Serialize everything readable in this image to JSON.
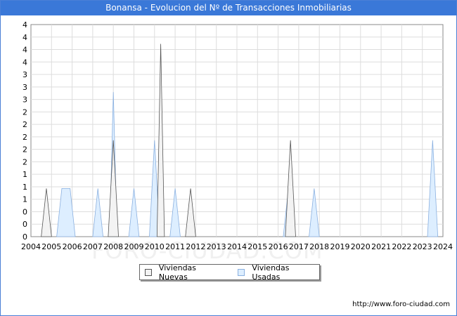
{
  "page": {
    "title": "Bonansa - Evolucion del Nº de Transacciones Inmobiliarias",
    "footer": "http://www.foro-ciudad.com",
    "watermark": "FORO-CIUDAD.COM"
  },
  "chart_data": {
    "type": "area",
    "title": "Bonansa - Evolucion del Nº de Transacciones Inmobiliarias",
    "x_ticks": [
      "2004",
      "2005",
      "2006",
      "2007",
      "2008",
      "2009",
      "2010",
      "2011",
      "2012",
      "2013",
      "2014",
      "2015",
      "2016",
      "2017",
      "2018",
      "2019",
      "2020",
      "2021",
      "2022",
      "2023",
      "2024"
    ],
    "y_ticks": [
      "0",
      "0",
      "0",
      "1",
      "1",
      "1",
      "2",
      "2",
      "2",
      "2",
      "2",
      "3",
      "3",
      "3",
      "4",
      "4",
      "4",
      "4"
    ],
    "ylim": [
      0,
      4.4
    ],
    "xlim": [
      2004,
      2024
    ],
    "grid": true,
    "legend_position": "bottom-center",
    "series": [
      {
        "name": "Viviendas Nuevas",
        "color": "#f3f3f3",
        "stroke": "#555555",
        "spikes": [
          {
            "x": 2004.75,
            "value": 1
          },
          {
            "x": 2008.0,
            "value": 2
          },
          {
            "x": 2010.3,
            "value": 4
          },
          {
            "x": 2011.75,
            "value": 1
          },
          {
            "x": 2016.6,
            "value": 2
          }
        ]
      },
      {
        "name": "Viviendas Usadas",
        "color": "#ddeeff",
        "stroke": "#8ab0e0",
        "plateaus": [
          {
            "start": 2005.5,
            "end": 2005.9,
            "value": 1
          }
        ],
        "spikes": [
          {
            "x": 2007.25,
            "value": 1
          },
          {
            "x": 2008.0,
            "value": 3
          },
          {
            "x": 2009.0,
            "value": 1
          },
          {
            "x": 2010.0,
            "value": 2
          },
          {
            "x": 2011.0,
            "value": 1
          },
          {
            "x": 2016.5,
            "value": 1
          },
          {
            "x": 2017.75,
            "value": 1
          },
          {
            "x": 2023.5,
            "value": 2
          }
        ]
      }
    ]
  }
}
